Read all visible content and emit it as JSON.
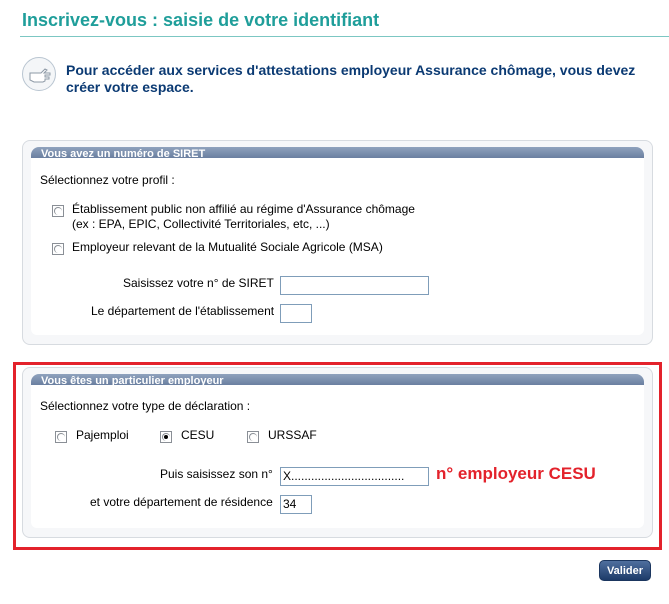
{
  "header": {
    "title": "Inscrivez-vous : saisie de votre identifiant"
  },
  "intro": {
    "icon": "pointing-hand-icon",
    "text": "Pour accéder aux services d'attestations employeur Assurance chômage, vous devez créer votre espace."
  },
  "siret_panel": {
    "heading": "Vous avez un numéro de SIRET",
    "profile_label": "Sélectionnez votre profil :",
    "options": [
      {
        "line1": "Établissement public non affilié au régime d'Assurance chômage",
        "line2": "(ex : EPA, EPIC, Collectivité Territoriales, etc, ...)",
        "selected": false
      },
      {
        "line1": "Employeur relevant de la Mutualité Sociale Agricole (MSA)",
        "selected": false
      }
    ],
    "siret_label": "Saisissez votre n° de SIRET",
    "siret_value": "",
    "dept_label": "Le département de l'établissement",
    "dept_value": ""
  },
  "private_panel": {
    "heading": "Vous êtes un particulier employeur",
    "declaration_label": "Sélectionnez votre type de déclaration :",
    "options": [
      {
        "label": "Pajemploi",
        "selected": false
      },
      {
        "label": "CESU",
        "selected": true
      },
      {
        "label": "URSSAF",
        "selected": false
      }
    ],
    "number_label": "Puis saisissez son n°",
    "number_value": "X..................................",
    "dept_label": "et votre département de résidence",
    "dept_value": "34"
  },
  "annotation": {
    "text": "n° employeur CESU",
    "color": "#e3222b"
  },
  "actions": {
    "submit_label": "Valider"
  },
  "colors": {
    "title": "#1f9e9a",
    "intro": "#0b3a73",
    "panel_header": "#6e84a6"
  }
}
